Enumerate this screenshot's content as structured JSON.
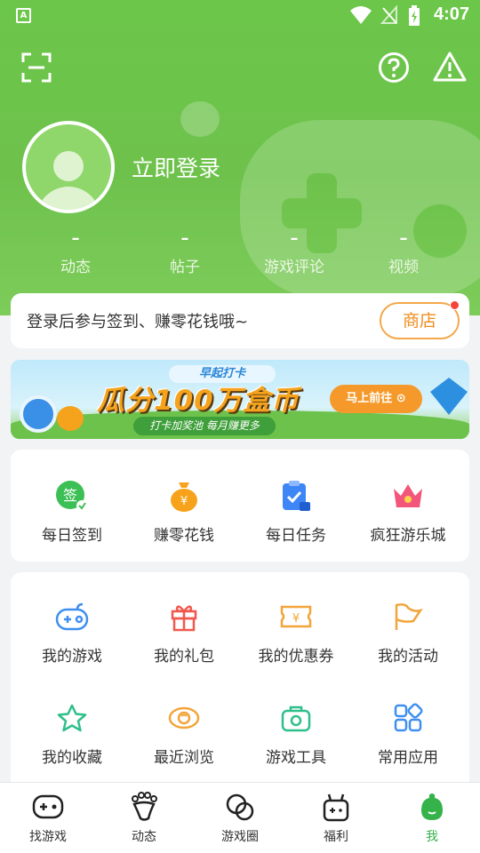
{
  "status": {
    "time": "4:07",
    "app_badge": "A"
  },
  "header": {
    "login_text": "立即登录"
  },
  "stats": [
    {
      "value": "–",
      "label": "动态"
    },
    {
      "value": "–",
      "label": "帖子"
    },
    {
      "value": "–",
      "label": "游戏评论"
    },
    {
      "value": "–",
      "label": "视频"
    }
  ],
  "signin": {
    "text": "登录后参与签到、赚零花钱哦~",
    "shop_label": "商店"
  },
  "banner": {
    "tag": "早起打卡",
    "headline": "瓜分100万盒币",
    "sub": "打卡加奖池  每月赚更多",
    "cta": "马上前往 ⊙"
  },
  "quick": [
    {
      "label": "每日签到",
      "icon": "sign-icon"
    },
    {
      "label": "赚零花钱",
      "icon": "money-bag-icon"
    },
    {
      "label": "每日任务",
      "icon": "task-clipboard-icon"
    },
    {
      "label": "疯狂游乐城",
      "icon": "crown-icon"
    }
  ],
  "mine": [
    {
      "label": "我的游戏",
      "icon": "gamepad-icon"
    },
    {
      "label": "我的礼包",
      "icon": "gift-icon"
    },
    {
      "label": "我的优惠券",
      "icon": "coupon-icon"
    },
    {
      "label": "我的活动",
      "icon": "flag-icon"
    },
    {
      "label": "我的收藏",
      "icon": "star-icon"
    },
    {
      "label": "最近浏览",
      "icon": "eye-icon"
    },
    {
      "label": "游戏工具",
      "icon": "toolbox-icon"
    },
    {
      "label": "常用应用",
      "icon": "apps-icon"
    }
  ],
  "tabs": [
    {
      "label": "找游戏",
      "icon": "gamepad-icon"
    },
    {
      "label": "动态",
      "icon": "paw-icon"
    },
    {
      "label": "游戏圈",
      "icon": "circles-icon"
    },
    {
      "label": "福利",
      "icon": "gift-box-icon"
    },
    {
      "label": "我",
      "icon": "mascot-icon",
      "active": true
    }
  ],
  "colors": {
    "hero_green": "#6cc64a",
    "accent_orange": "#f08c1c",
    "active_tab": "#36b24a"
  }
}
